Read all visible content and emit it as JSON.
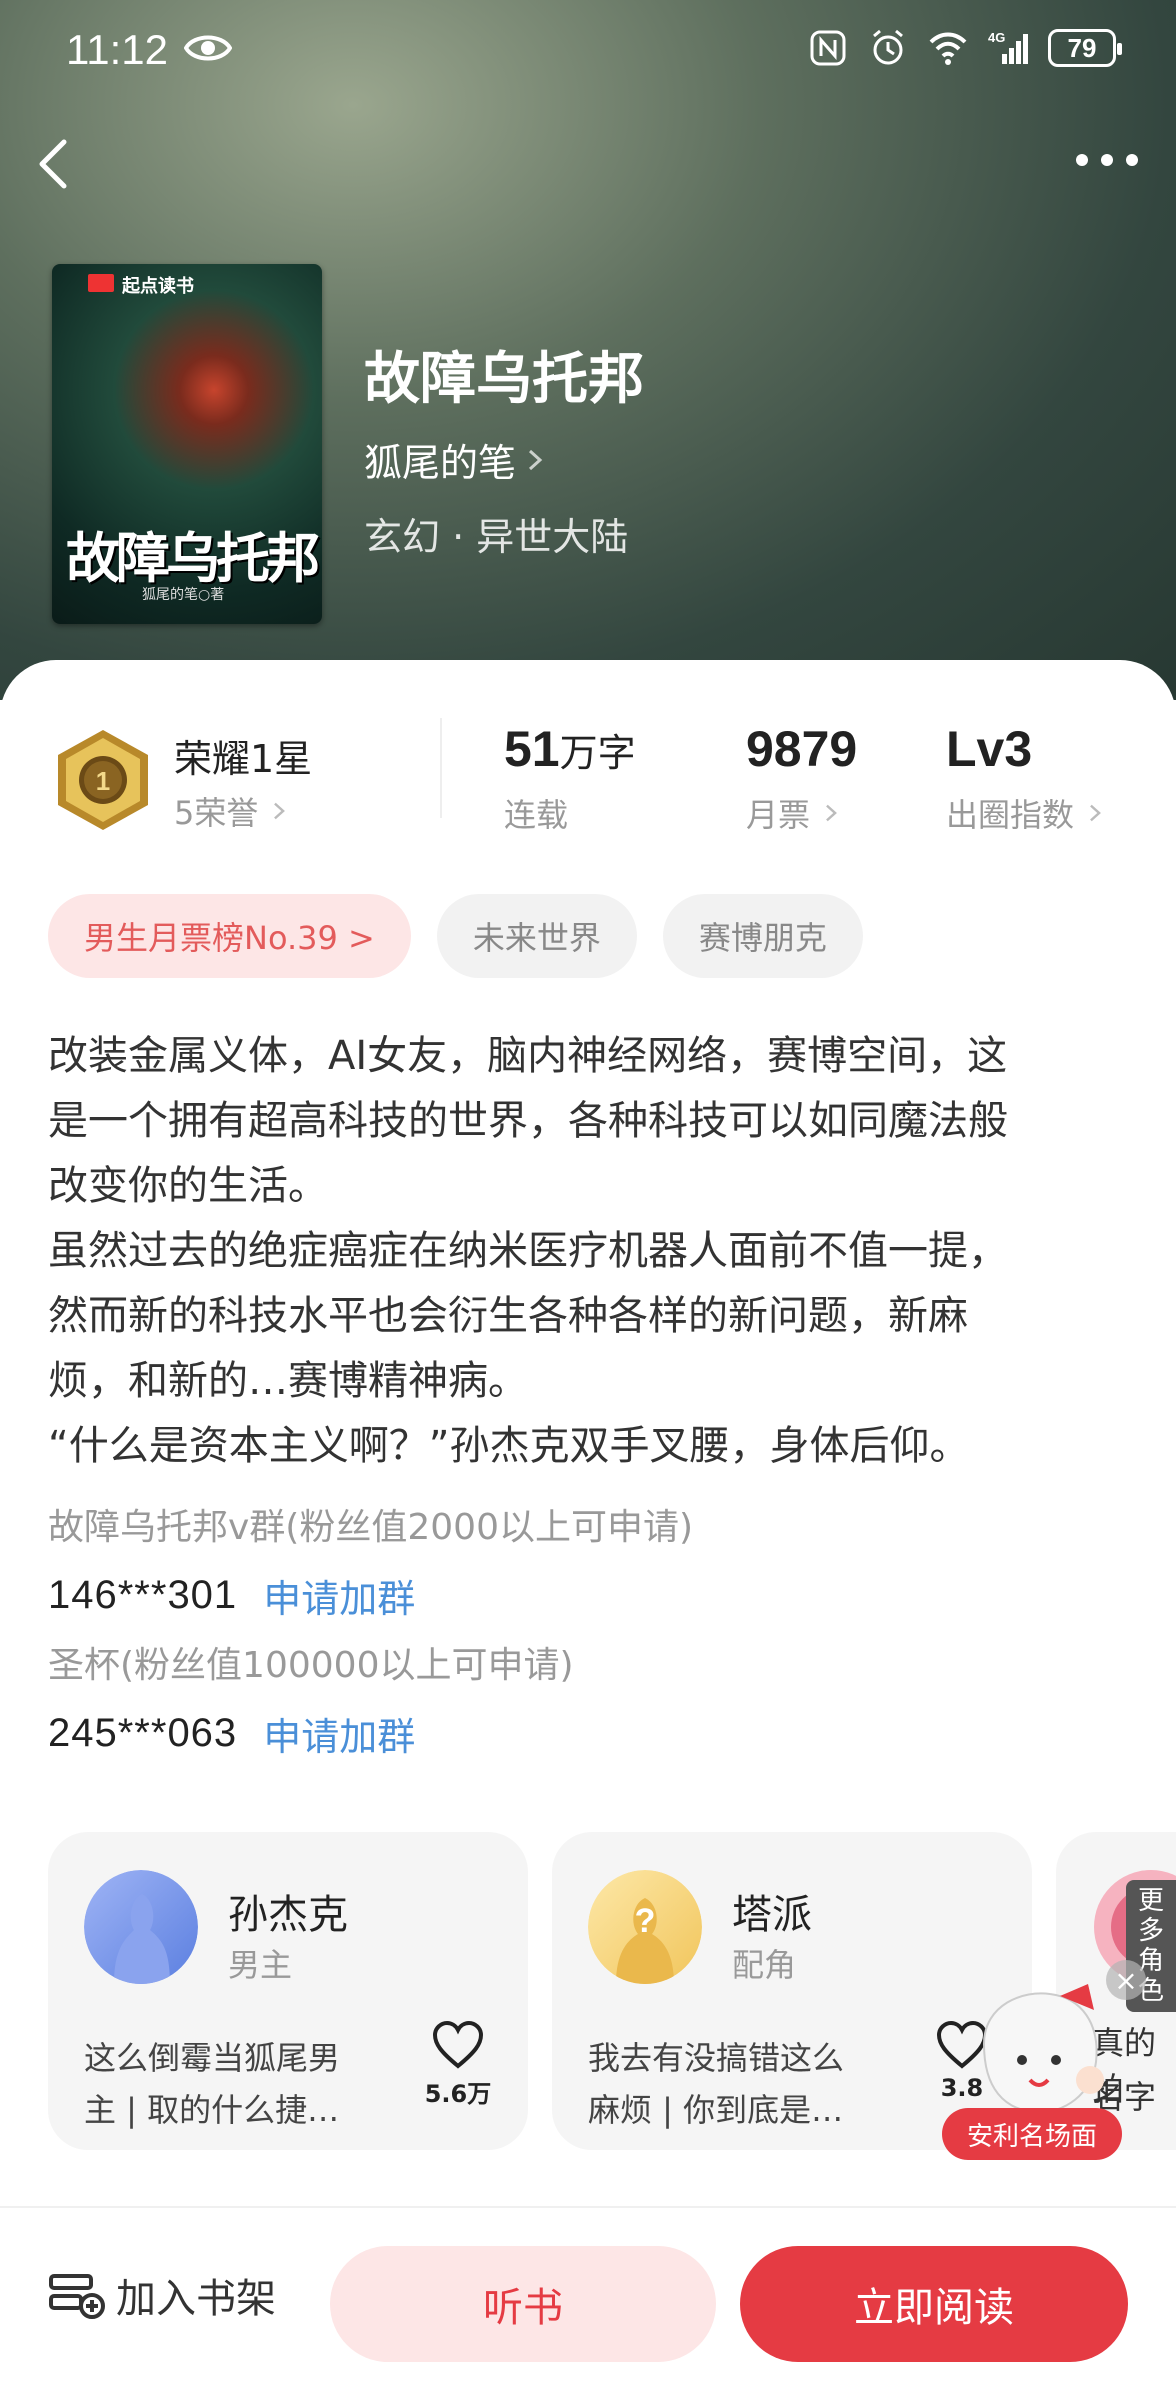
{
  "status_bar": {
    "time": "11:12",
    "battery": "79",
    "icons": [
      "eye-icon",
      "nfc-icon",
      "alarm-icon",
      "wifi-icon",
      "signal-4g-icon"
    ]
  },
  "nav": {
    "back_icon": "chevron-left-icon",
    "more_icon": "more-dots-icon"
  },
  "book": {
    "cover": {
      "brand": "起点读书",
      "title": "故障乌托邦",
      "author_line": "狐尾的笔○著"
    },
    "title": "故障乌托邦",
    "author": "狐尾的笔",
    "genre": "玄幻 · 异世大陆"
  },
  "honor": {
    "title": "荣耀1星",
    "subtitle": "5荣誉"
  },
  "stats": [
    {
      "value": "51",
      "unit": "万字",
      "label": "连载"
    },
    {
      "value": "9879",
      "unit": "",
      "label": "月票"
    },
    {
      "value": "Lv3",
      "unit": "",
      "label": "出圈指数"
    }
  ],
  "tags": [
    "男生月票榜No.39 >",
    "未来世界",
    "赛博朋克"
  ],
  "synopsis": [
    "改装金属义体，AI女友，脑内神经网络，赛博空间，这",
    "是一个拥有超高科技的世界，各种科技可以如同魔法般",
    "改变你的生活。",
    "虽然过去的绝症癌症在纳米医疗机器人面前不值一提，",
    "然而新的科技水平也会衍生各种各样的新问题，新麻",
    "烦，和新的…赛博精神病。",
    "“什么是资本主义啊？”孙杰克双手叉腰，身体后仰。"
  ],
  "groups": [
    {
      "name": "故障乌托邦v群(粉丝值2000以上可申请)",
      "number": "146***301",
      "action": "申请加群"
    },
    {
      "name": "圣杯(粉丝值100000以上可申请)",
      "number": "245***063",
      "action": "申请加群"
    }
  ],
  "characters": [
    {
      "name": "孙杰克",
      "role": "男主",
      "desc_lines": [
        "这么倒霉当狐尾男",
        "主 | 取的什么捷…"
      ],
      "likes": "5.6万"
    },
    {
      "name": "塔派",
      "role": "配角",
      "desc_lines": [
        "我去有没搞错这么",
        "麻烦 | 你到底是…"
      ],
      "likes": "3.8"
    }
  ],
  "third_card": {
    "more_roles": "更多角色",
    "lines": [
      "真的拍",
      "名字"
    ]
  },
  "floating": {
    "close": "×",
    "badge": "安利名场面"
  },
  "bottom_bar": {
    "shelf": "加入书架",
    "listen": "听书",
    "read": "立即阅读"
  },
  "colors": {
    "accent": "#e53b43",
    "link": "#4a8fd8",
    "tag_rank_bg": "#fde6e6"
  }
}
